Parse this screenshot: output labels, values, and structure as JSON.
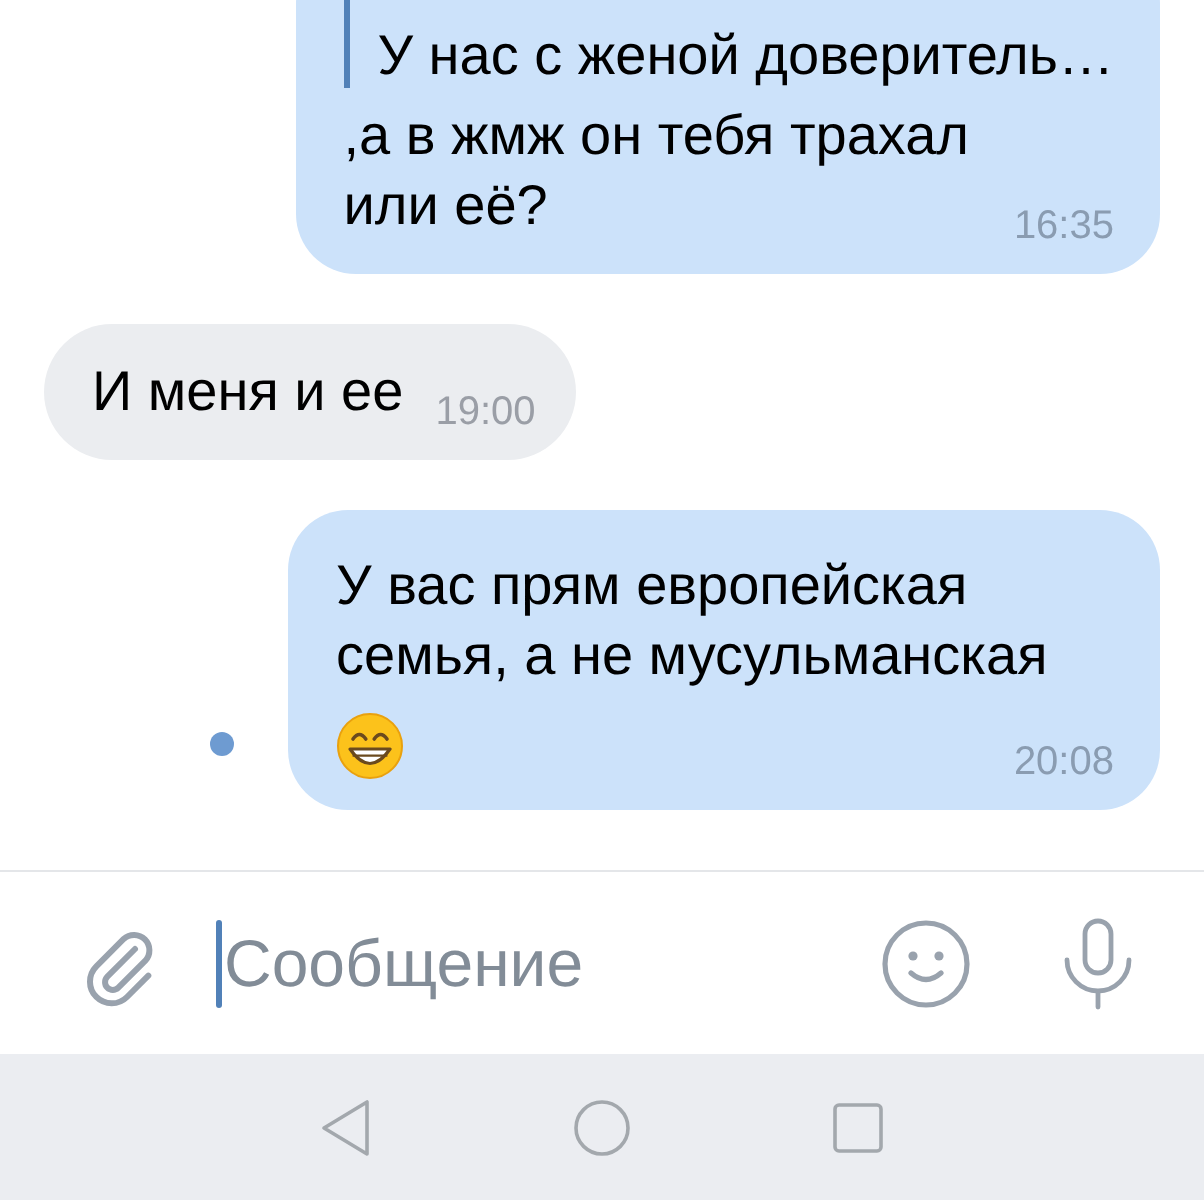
{
  "messages": [
    {
      "kind": "outgoing",
      "reply": {
        "text": "У нас с женой доверитель…"
      },
      "blocks": [
        {
          "kind": "text",
          "text": ",а в жмж он тебя трахал\nили её?"
        }
      ],
      "time": "16:35",
      "unread": false
    },
    {
      "kind": "incoming",
      "blocks": [
        {
          "kind": "text",
          "text": "И меня и ее"
        }
      ],
      "time": "19:00",
      "unread": false
    },
    {
      "kind": "outgoing",
      "blocks": [
        {
          "kind": "text",
          "text": "У вас прям европейская семья, а не мусульманская"
        },
        {
          "kind": "emoji"
        }
      ],
      "time": "20:08",
      "unread": true
    }
  ],
  "composer": {
    "placeholder": "Сообщение",
    "focused": true
  }
}
